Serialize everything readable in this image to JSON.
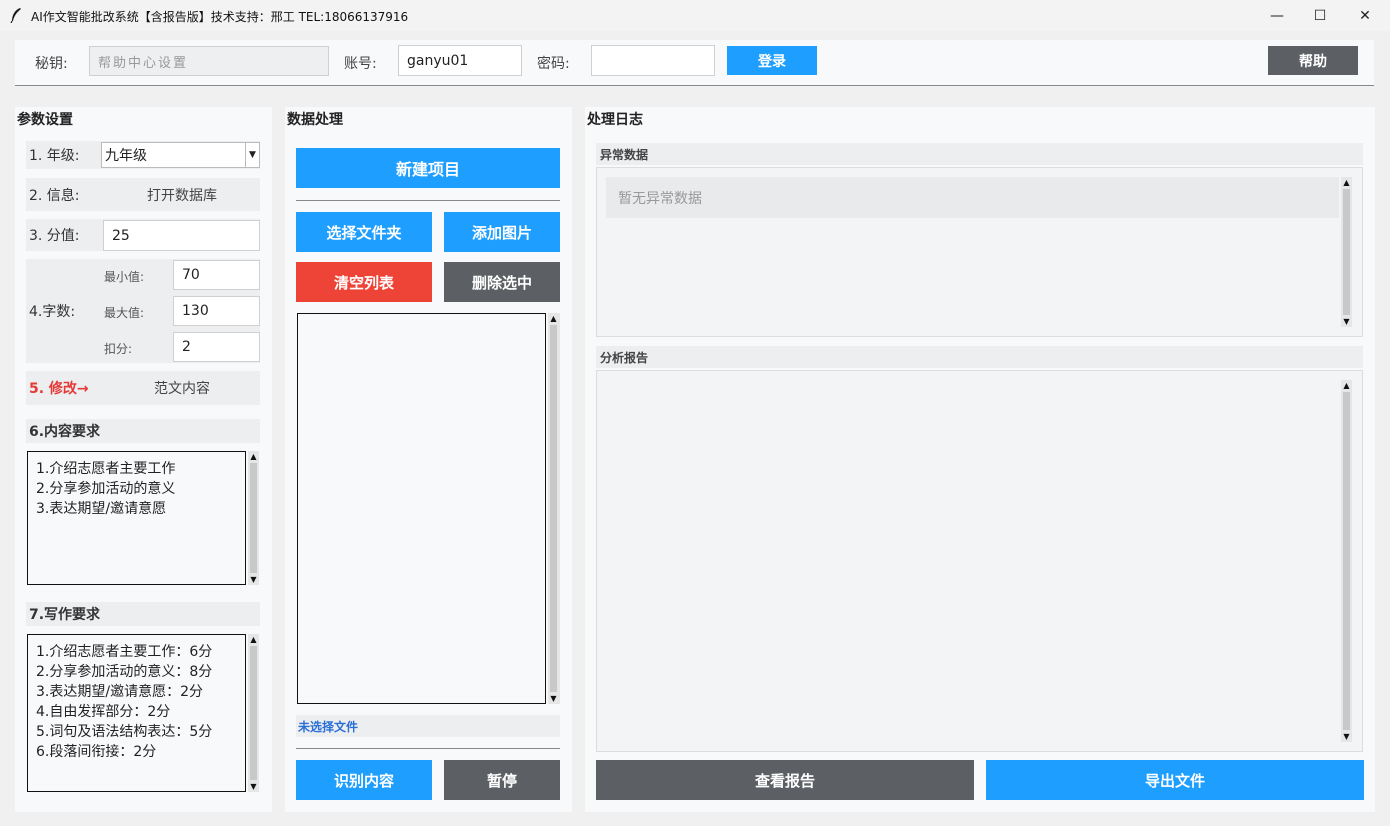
{
  "window": {
    "title": "AI作文智能批改系统【含报告版】技术支持：邢工 TEL:18066137916",
    "controls": [
      "—",
      "☐",
      "✕"
    ]
  },
  "login": {
    "key_label": "秘钥:",
    "key_value": "帮助中心设置",
    "account_label": "账号:",
    "account_value": "ganyu01",
    "password_label": "密码:",
    "password_value": "",
    "login_button": "登录",
    "help_button": "帮助"
  },
  "params": {
    "title": "参数设置",
    "grade_label": "1. 年级:",
    "grade_value": "九年级",
    "info_label": "2. 信息:",
    "info_button": "打开数据库",
    "score_label": "3. 分值:",
    "score_value": "25",
    "words_label": "4.字数:",
    "min_label": "最小值:",
    "min_value": "70",
    "max_label": "最大值:",
    "max_value": "130",
    "deduct_label": "扣分:",
    "deduct_value": "2",
    "modify_label": "5. 修改→",
    "sample_button": "范文内容",
    "content_title": "6.内容要求",
    "content_text": "1.介绍志愿者主要工作\n2.分享参加活动的意义\n3.表达期望/邀请意愿",
    "writing_title": "7.写作要求",
    "writing_text": "1.介绍志愿者主要工作：6分\n2.分享参加活动的意义：8分\n3.表达期望/邀请意愿：2分\n4.自由发挥部分：2分\n5.词句及语法结构表达：5分\n6.段落间衔接：2分"
  },
  "data": {
    "title": "数据处理",
    "new_project": "新建项目",
    "select_folder": "选择文件夹",
    "add_image": "添加图片",
    "clear_list": "清空列表",
    "delete_selected": "删除选中",
    "no_file": "未选择文件",
    "recognize": "识别内容",
    "pause": "暂停"
  },
  "log": {
    "title": "处理日志",
    "abnormal_title": "异常数据",
    "abnormal_placeholder": "暂无异常数据",
    "report_title": "分析报告",
    "view_report": "查看报告",
    "export_file": "导出文件"
  },
  "colors": {
    "accent_blue": "#1e9eff",
    "danger_red": "#ee4438",
    "neutral_gray": "#5c6064",
    "modify_red": "#e53935",
    "link_blue": "#2a6fd6"
  }
}
